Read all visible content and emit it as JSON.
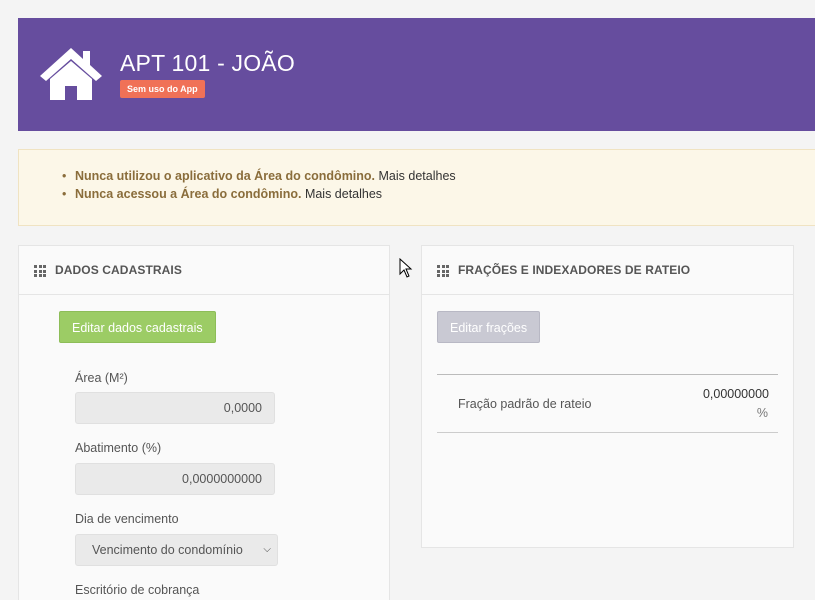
{
  "header": {
    "title": "APT 101 - JOÃO",
    "badge": "Sem uso do App",
    "background_color": "#664d9e",
    "badge_color": "#f07157",
    "icon": "home-icon"
  },
  "alert": {
    "items": [
      {
        "strong": "Nunca utilizou o aplicativo da Área do condômino.",
        "link": "Mais detalhes"
      },
      {
        "strong": "Nunca acessou a Área do condômino.",
        "link": "Mais detalhes"
      }
    ]
  },
  "dados_cadastrais": {
    "title": "DADOS CADASTRAIS",
    "icon": "grid-icon",
    "edit_button": "Editar dados cadastrais",
    "edit_button_color": "#9ccc65",
    "fields": {
      "area_label": "Área (M²)",
      "area_value": "0,0000",
      "abatimento_label": "Abatimento (%)",
      "abatimento_value": "0,0000000000",
      "vencimento_label": "Dia de vencimento",
      "vencimento_value": "Vencimento do condomínio",
      "escritorio_label": "Escritório de cobrança"
    }
  },
  "fracoes": {
    "title": "FRAÇÕES E INDEXADORES DE RATEIO",
    "icon": "grid-icon",
    "edit_button": "Editar frações",
    "row": {
      "label": "Fração padrão de rateio",
      "value": "0,00000000",
      "unit": "%"
    }
  }
}
